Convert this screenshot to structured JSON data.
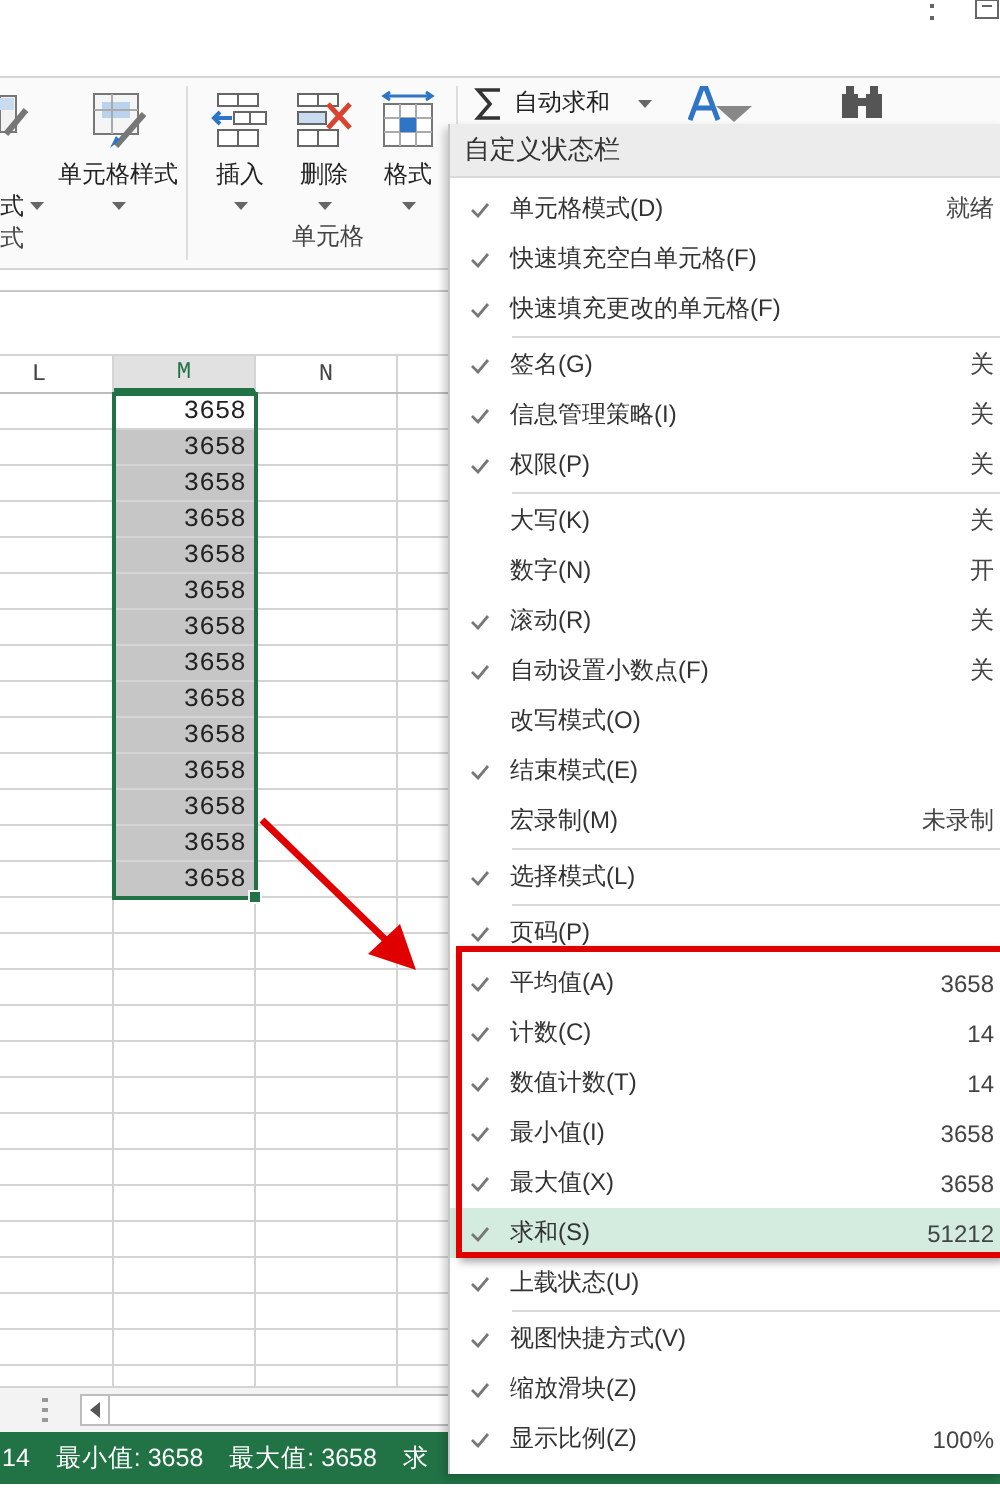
{
  "ribbon": {
    "groups": [
      {
        "label": "式",
        "buttons": [
          {
            "kind": "tablestyle",
            "lines": [
              "式"
            ],
            "dropdown": true
          },
          {
            "kind": "cellstyle",
            "lines": [
              "单元格样式"
            ],
            "dropdown": true
          }
        ]
      },
      {
        "label": "单元格",
        "buttons": [
          {
            "kind": "insert",
            "lines": [
              "插入"
            ],
            "dropdown": true
          },
          {
            "kind": "delete",
            "lines": [
              "删除"
            ],
            "dropdown": true
          },
          {
            "kind": "format",
            "lines": [
              "格式"
            ],
            "dropdown": true
          }
        ]
      }
    ],
    "autosum": {
      "label": "自动求和",
      "dropdown": true
    }
  },
  "sheet": {
    "columns": [
      {
        "label": "L",
        "selected": false
      },
      {
        "label": "M",
        "selected": true
      },
      {
        "label": "N",
        "selected": false
      }
    ],
    "cells": [
      {
        "value": "3658",
        "active": true
      },
      {
        "value": "3658",
        "active": false
      },
      {
        "value": "3658",
        "active": false
      },
      {
        "value": "3658",
        "active": false
      },
      {
        "value": "3658",
        "active": false
      },
      {
        "value": "3658",
        "active": false
      },
      {
        "value": "3658",
        "active": false
      },
      {
        "value": "3658",
        "active": false
      },
      {
        "value": "3658",
        "active": false
      },
      {
        "value": "3658",
        "active": false
      },
      {
        "value": "3658",
        "active": false
      },
      {
        "value": "3658",
        "active": false
      },
      {
        "value": "3658",
        "active": false
      },
      {
        "value": "3658",
        "active": false
      }
    ]
  },
  "status_bar": [
    "14",
    "最小值: 3658",
    "最大值: 3658",
    "求"
  ],
  "menu": {
    "title": "自定义状态栏",
    "items": [
      {
        "kind": "item",
        "label": "单元格模式(D)",
        "value": "就绪",
        "checked": true,
        "selected": false
      },
      {
        "kind": "item",
        "label": "快速填充空白单元格(F)",
        "checked": true,
        "selected": false
      },
      {
        "kind": "item",
        "label": "快速填充更改的单元格(F)",
        "checked": true,
        "selected": false
      },
      {
        "kind": "separator"
      },
      {
        "kind": "item",
        "label": "签名(G)",
        "value": "关",
        "checked": true,
        "selected": false
      },
      {
        "kind": "item",
        "label": "信息管理策略(I)",
        "value": "关",
        "checked": true,
        "selected": false
      },
      {
        "kind": "item",
        "label": "权限(P)",
        "value": "关",
        "checked": true,
        "selected": false
      },
      {
        "kind": "separator"
      },
      {
        "kind": "item",
        "label": "大写(K)",
        "value": "关",
        "checked": false,
        "selected": false
      },
      {
        "kind": "item",
        "label": "数字(N)",
        "value": "开",
        "checked": false,
        "selected": false
      },
      {
        "kind": "item",
        "label": "滚动(R)",
        "value": "关",
        "checked": true,
        "selected": false
      },
      {
        "kind": "item",
        "label": "自动设置小数点(F)",
        "value": "关",
        "checked": true,
        "selected": false
      },
      {
        "kind": "item",
        "label": "改写模式(O)",
        "checked": false,
        "selected": false
      },
      {
        "kind": "item",
        "label": "结束模式(E)",
        "checked": true,
        "selected": false
      },
      {
        "kind": "item",
        "label": "宏录制(M)",
        "value": "未录制",
        "checked": false,
        "selected": false
      },
      {
        "kind": "separator"
      },
      {
        "kind": "item",
        "label": "选择模式(L)",
        "checked": true,
        "selected": false
      },
      {
        "kind": "separator"
      },
      {
        "kind": "item",
        "label": "页码(P)",
        "checked": true,
        "selected": false
      },
      {
        "kind": "item",
        "label": "平均值(A)",
        "value": "3658",
        "checked": true,
        "selected": false
      },
      {
        "kind": "item",
        "label": "计数(C)",
        "value": "14",
        "checked": true,
        "selected": false
      },
      {
        "kind": "item",
        "label": "数值计数(T)",
        "value": "14",
        "checked": true,
        "selected": false
      },
      {
        "kind": "item",
        "label": "最小值(I)",
        "value": "3658",
        "checked": true,
        "selected": false
      },
      {
        "kind": "item",
        "label": "最大值(X)",
        "value": "3658",
        "checked": true,
        "selected": false
      },
      {
        "kind": "item",
        "label": "求和(S)",
        "value": "51212",
        "checked": true,
        "selected": true
      },
      {
        "kind": "item",
        "label": "上载状态(U)",
        "checked": true,
        "selected": false
      },
      {
        "kind": "separator"
      },
      {
        "kind": "item",
        "label": "视图快捷方式(V)",
        "checked": true,
        "selected": false
      },
      {
        "kind": "item",
        "label": "缩放滑块(Z)",
        "checked": true,
        "selected": false
      },
      {
        "kind": "item",
        "label": "显示比例(Z)",
        "value": "100%",
        "checked": true,
        "selected": false
      }
    ]
  }
}
